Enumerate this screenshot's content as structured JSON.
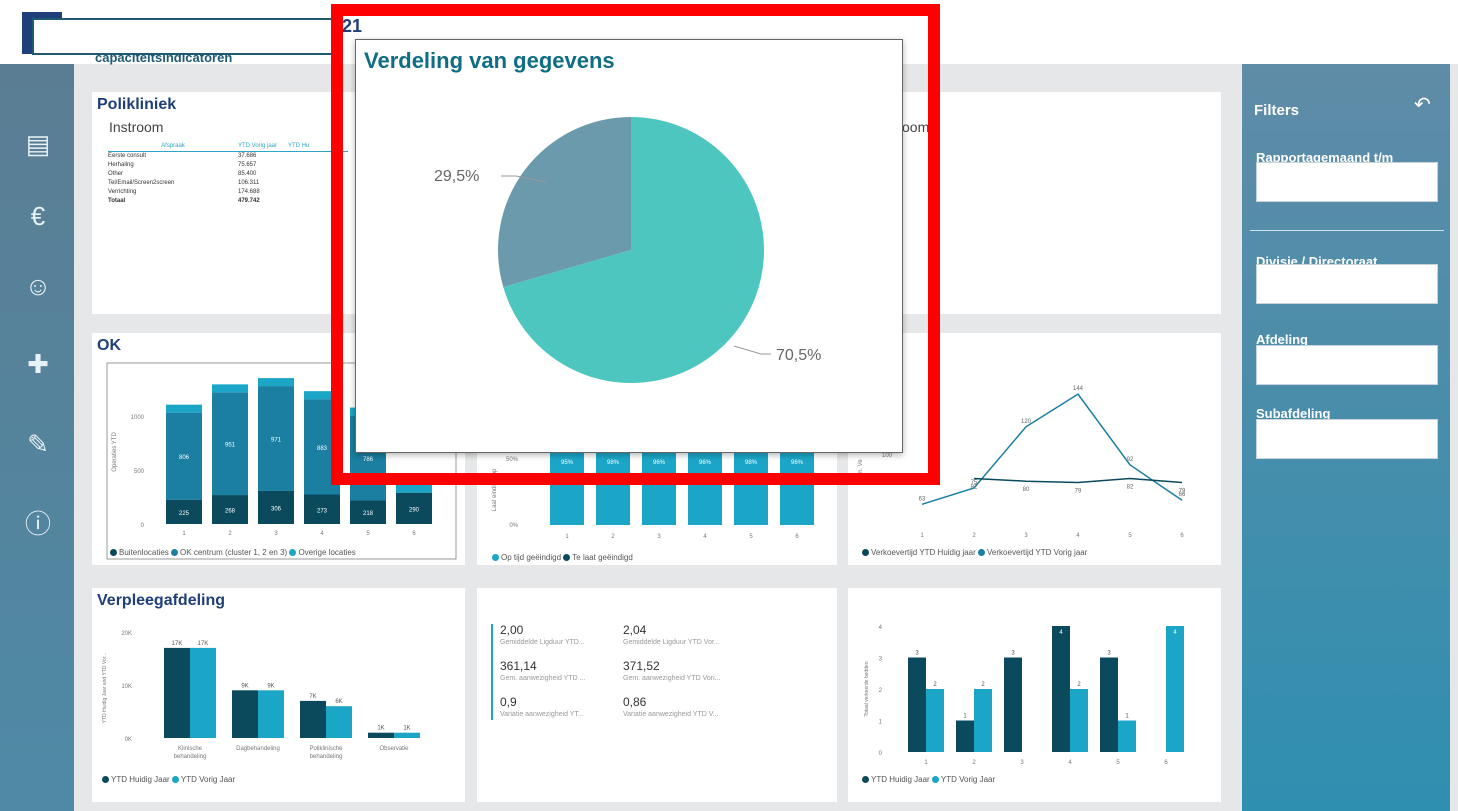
{
  "app": {
    "title_fragment": "21",
    "subtitle": "capaciteitsindicatoren"
  },
  "nav_icons": [
    "news-icon",
    "money-bag-icon",
    "people-icon",
    "medical-kit-icon",
    "ruler-icon",
    "info-icon"
  ],
  "filters": {
    "heading": "Filters",
    "undo_icon": "undo-icon",
    "items": [
      {
        "label": "Rapportagemaand t/m"
      },
      {
        "label": "Divisie / Directoraat"
      },
      {
        "label": "Afdeling"
      },
      {
        "label": "Subafdeling"
      }
    ]
  },
  "polikliniek": {
    "title": "Polikliniek",
    "subtitle": "Instroom",
    "table_headers": [
      "Afspraak",
      "YTD Vorig jaar",
      "YTD Hu"
    ],
    "rows": [
      [
        "Eerste consult",
        "37.686"
      ],
      [
        "Herhaling",
        "75.657"
      ],
      [
        "Other",
        "85.400"
      ],
      [
        "Tel/Email/Screen2screen",
        "106.311"
      ],
      [
        "Verrichting",
        "174.688"
      ],
      [
        "Totaal",
        "479.742"
      ]
    ],
    "right_fragment": "oom"
  },
  "ok": {
    "title": "OK",
    "ylabel": "Operaties YTD",
    "legend": [
      "Buitenlocaties",
      "OK centrum (cluster 1, 2 en 3)",
      "Overige locaties"
    ]
  },
  "middle_chart": {
    "ylabel": "Laat eindigd, op",
    "legend": [
      "Op tijd geëindigd",
      "Te laat geëindigd"
    ]
  },
  "right_chart": {
    "ylabel": "m. Ve",
    "legend": [
      "Verkoevertijd YTD Huidig jaar",
      "Verkoevertijd YTD Vorig jaar"
    ]
  },
  "verpleeg": {
    "title": "Verpleegafdeling",
    "ylabel": "YTD Huidig Jaar and YTD Vor...",
    "legend": [
      "YTD Huidig Jaar",
      "YTD Vorig Jaar"
    ]
  },
  "kpi": {
    "items": [
      {
        "value": "2,00",
        "label": "Gemiddelde Ligduur YTD..."
      },
      {
        "value": "2,04",
        "label": "Gemiddelde Ligduur YTD Vor..."
      },
      {
        "value": "361,14",
        "label": "Gem. aanwezigheid YTD ..."
      },
      {
        "value": "371,52",
        "label": "Gem. aanwezigheid YTD Vori..."
      },
      {
        "value": "0,9",
        "label": "Variatie aanwezigheid YT..."
      },
      {
        "value": "0,86",
        "label": "Variatie aanwezigheid YTD V..."
      }
    ]
  },
  "bottom_right": {
    "ylabel": "Totaal verkeerde bedden",
    "legend": [
      "YTD Huidig Jaar",
      "YTD Vorig Jaar"
    ]
  },
  "popup": {
    "title": "Verdeling van gegevens"
  },
  "colors": {
    "dark_teal": "#0b4a5c",
    "mid_teal": "#1a7fa0",
    "light_cyan": "#1ba6c8",
    "pie_teal": "#4dc6bf",
    "pie_gray": "#6b9aac",
    "highlight_red": "#ff0000"
  },
  "chart_data": [
    {
      "type": "pie",
      "id": "verdeling",
      "labels": [
        "29,5%",
        "70,5%"
      ],
      "values": [
        29.5,
        70.5
      ]
    },
    {
      "type": "bar",
      "id": "ok",
      "stacked": true,
      "categories": [
        "1",
        "2",
        "3",
        "4",
        "5",
        "6"
      ],
      "series": [
        {
          "name": "Buitenlocaties",
          "values": [
            225,
            268,
            306,
            273,
            218,
            290
          ]
        },
        {
          "name": "OK centrum (cluster 1, 2 en 3)",
          "values": [
            806,
            951,
            971,
            883,
            786,
            null
          ]
        },
        {
          "name": "Overige locaties",
          "values": [
            null,
            null,
            null,
            null,
            null,
            null
          ]
        }
      ],
      "yticks": [
        "0",
        "500",
        "1000"
      ]
    },
    {
      "type": "bar",
      "id": "middle",
      "categories": [
        "1",
        "2",
        "3",
        "4",
        "5",
        "6"
      ],
      "labels": [
        "95%",
        "98%",
        "96%",
        "96%",
        "98%",
        "96%"
      ],
      "yticks": [
        "0%",
        "50%"
      ]
    },
    {
      "type": "line",
      "id": "verkoevertijd",
      "categories": [
        "1",
        "2",
        "3",
        "4",
        "5",
        "6"
      ],
      "series": [
        {
          "name": "Verkoevertijd YTD Huidig jaar",
          "values": [
            63,
            75,
            120,
            144,
            92,
            66
          ]
        },
        {
          "name": "Verkoevertijd YTD Vorig jaar",
          "values": [
            null,
            82,
            80,
            79,
            82,
            79
          ]
        }
      ],
      "yticks": [
        "100"
      ]
    },
    {
      "type": "bar",
      "id": "verpleeg",
      "categories": [
        "Klinische behandeling",
        "Dagbehandeling",
        "Poliklinische behandeling",
        "Observatie"
      ],
      "series": [
        {
          "name": "YTD Huidig Jaar",
          "values": [
            17000,
            9000,
            7000,
            1000
          ],
          "labels": [
            "17K",
            "9K",
            "7K",
            "1K"
          ]
        },
        {
          "name": "YTD Vorig Jaar",
          "values": [
            17000,
            9000,
            6000,
            1000
          ],
          "labels": [
            "17K",
            "9K",
            "6K",
            "1K"
          ]
        }
      ],
      "yticks": [
        "0K",
        "10K",
        "20K"
      ]
    },
    {
      "type": "bar",
      "id": "verkeerde-bedden",
      "categories": [
        "1",
        "2",
        "3",
        "4",
        "5",
        "6"
      ],
      "series": [
        {
          "name": "YTD Huidig Jaar",
          "values": [
            3,
            1,
            3,
            4,
            3,
            null
          ]
        },
        {
          "name": "YTD Vorig Jaar",
          "values": [
            2,
            2,
            null,
            2,
            1,
            4
          ]
        }
      ],
      "yticks": [
        "0",
        "1",
        "2",
        "3",
        "4"
      ]
    }
  ]
}
